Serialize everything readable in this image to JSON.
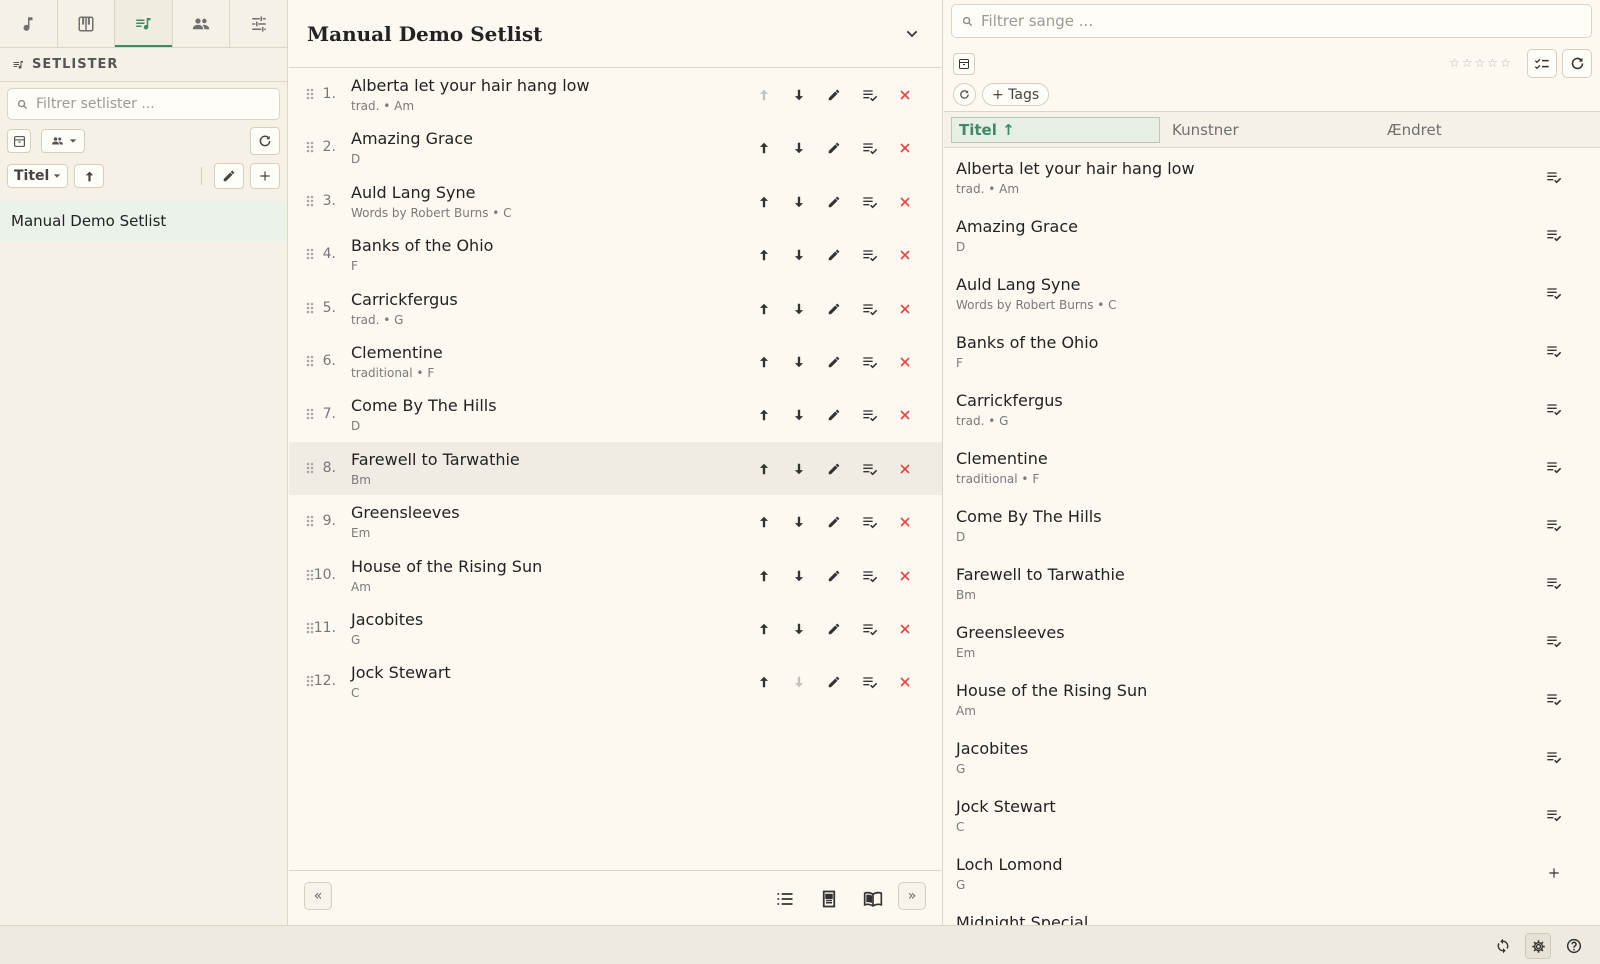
{
  "sidebar": {
    "nav_tabs": [
      {
        "icon": "music-note-icon"
      },
      {
        "icon": "piano-icon"
      },
      {
        "icon": "setlist-icon",
        "active": true
      },
      {
        "icon": "people-icon"
      },
      {
        "icon": "sliders-icon"
      }
    ],
    "section_title": "SETLISTER",
    "filter_placeholder": "Filtrer setlister ...",
    "sort_label": "Titel",
    "setlists": [
      "Manual Demo Setlist"
    ]
  },
  "setlist": {
    "title": "Manual Demo Setlist",
    "songs": [
      {
        "num": "1.",
        "title": "Alberta let your hair hang low",
        "sub": "trad. • Am"
      },
      {
        "num": "2.",
        "title": "Amazing Grace",
        "sub": "D"
      },
      {
        "num": "3.",
        "title": "Auld Lang Syne",
        "sub": "Words by Robert Burns • C"
      },
      {
        "num": "4.",
        "title": "Banks of the Ohio",
        "sub": "F"
      },
      {
        "num": "5.",
        "title": "Carrickfergus",
        "sub": "trad. • G"
      },
      {
        "num": "6.",
        "title": "Clementine",
        "sub": "traditional • F"
      },
      {
        "num": "7.",
        "title": "Come By The Hills",
        "sub": "D"
      },
      {
        "num": "8.",
        "title": "Farewell to Tarwathie",
        "sub": "Bm"
      },
      {
        "num": "9.",
        "title": "Greensleeves",
        "sub": "Em"
      },
      {
        "num": "10.",
        "title": "House of the Rising Sun",
        "sub": "Am"
      },
      {
        "num": "11.",
        "title": "Jacobites",
        "sub": "G"
      },
      {
        "num": "12.",
        "title": "Jock Stewart",
        "sub": "C"
      }
    ],
    "highlighted_index": 7
  },
  "library": {
    "search_placeholder": "Filtrer sange ...",
    "tags_label": "+ Tags",
    "columns": [
      "Titel ↑",
      "Kunstner",
      "Ændret"
    ],
    "songs": [
      {
        "title": "Alberta let your hair hang low",
        "sub": "trad. • Am",
        "in_setlist": true
      },
      {
        "title": "Amazing Grace",
        "sub": "D",
        "in_setlist": true
      },
      {
        "title": "Auld Lang Syne",
        "sub": "Words by Robert Burns • C",
        "in_setlist": true
      },
      {
        "title": "Banks of the Ohio",
        "sub": "F",
        "in_setlist": true
      },
      {
        "title": "Carrickfergus",
        "sub": "trad. • G",
        "in_setlist": true
      },
      {
        "title": "Clementine",
        "sub": "traditional • F",
        "in_setlist": true
      },
      {
        "title": "Come By The Hills",
        "sub": "D",
        "in_setlist": true
      },
      {
        "title": "Farewell to Tarwathie",
        "sub": "Bm",
        "in_setlist": true
      },
      {
        "title": "Greensleeves",
        "sub": "Em",
        "in_setlist": true
      },
      {
        "title": "House of the Rising Sun",
        "sub": "Am",
        "in_setlist": true
      },
      {
        "title": "Jacobites",
        "sub": "G",
        "in_setlist": true
      },
      {
        "title": "Jock Stewart",
        "sub": "C",
        "in_setlist": true
      },
      {
        "title": "Loch Lomond",
        "sub": "G",
        "in_setlist": false
      },
      {
        "title": "Midnight Special",
        "sub": "",
        "in_setlist": false
      }
    ]
  },
  "colors": {
    "accent": "#3e8a64",
    "danger": "#e54343",
    "background": "#fcf8f0"
  }
}
